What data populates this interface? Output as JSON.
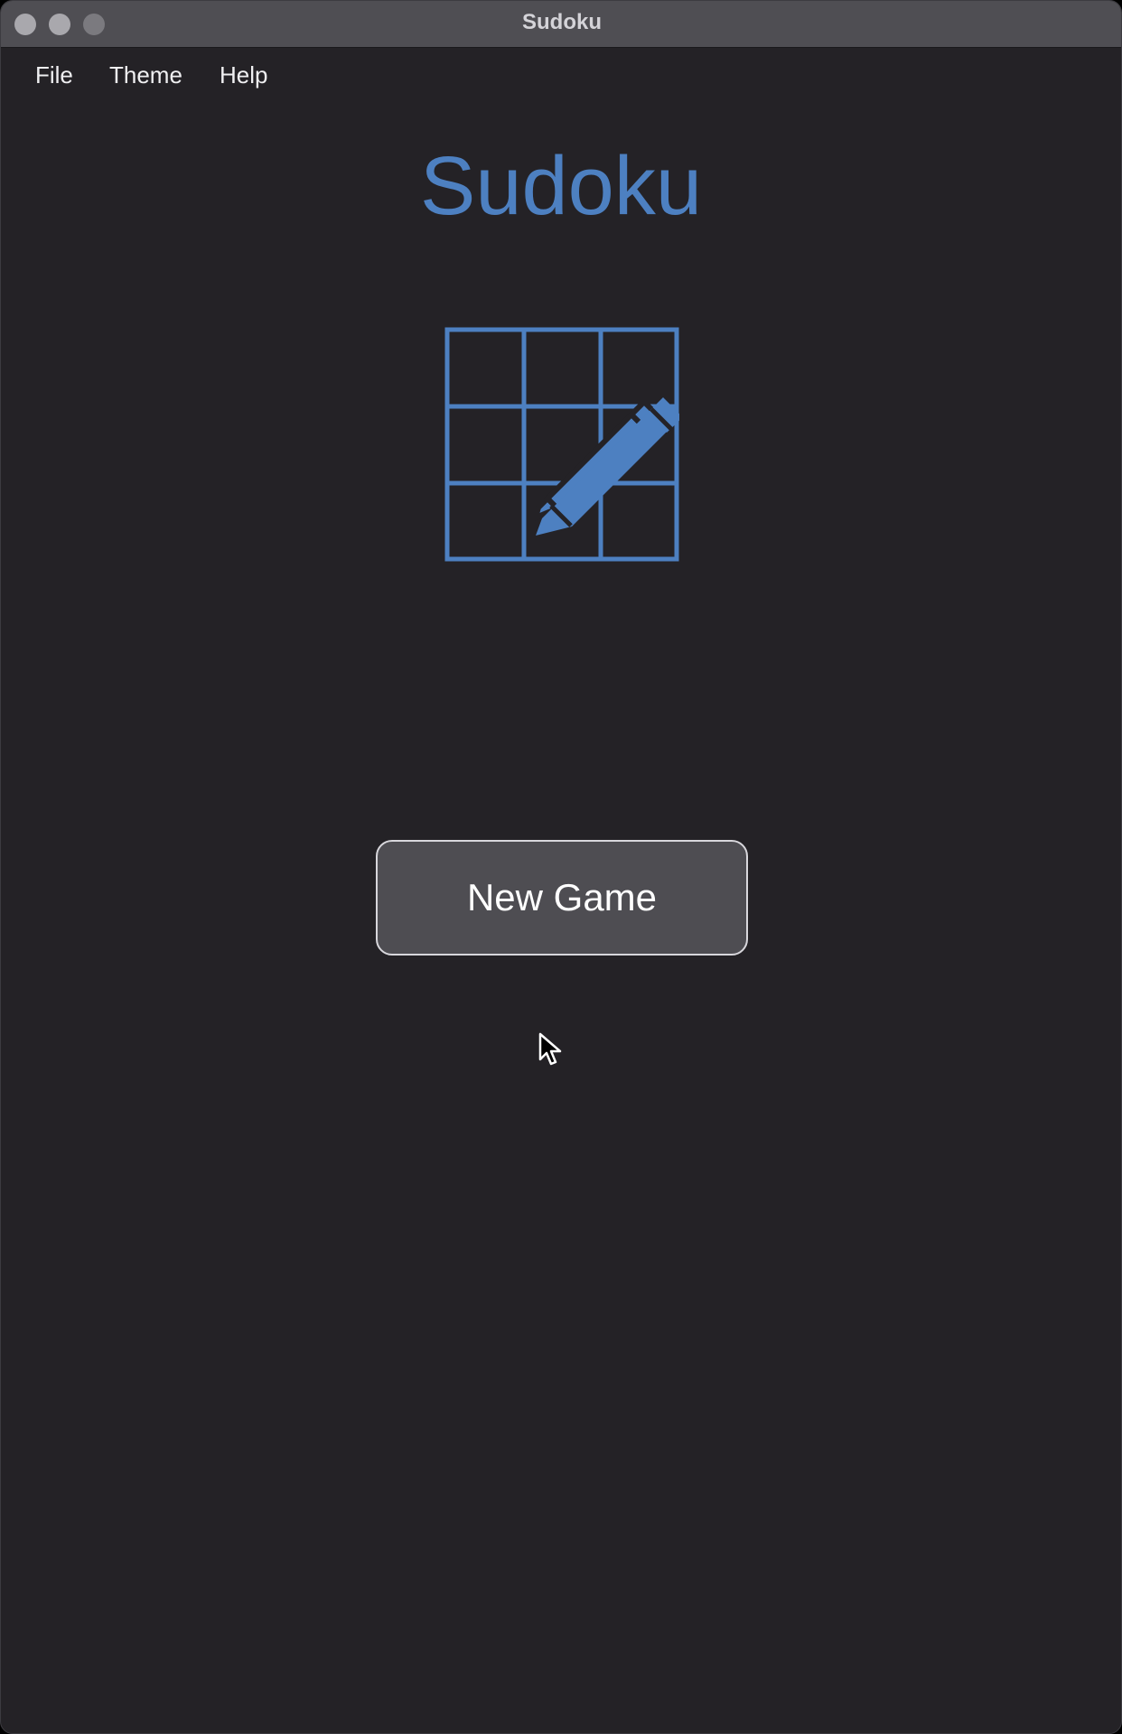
{
  "window": {
    "title": "Sudoku"
  },
  "menubar": {
    "items": [
      {
        "label": "File"
      },
      {
        "label": "Theme"
      },
      {
        "label": "Help"
      }
    ]
  },
  "main": {
    "app_title": "Sudoku",
    "logo_icon": "sudoku-grid-pencil-icon",
    "new_game_label": "New Game"
  },
  "colors": {
    "background": "#242226",
    "titlebar": "#4f4e53",
    "accent": "#4d80c1",
    "button_fill": "#4e4d52",
    "button_border": "#d8d7dc",
    "text": "#f0f0f2"
  }
}
